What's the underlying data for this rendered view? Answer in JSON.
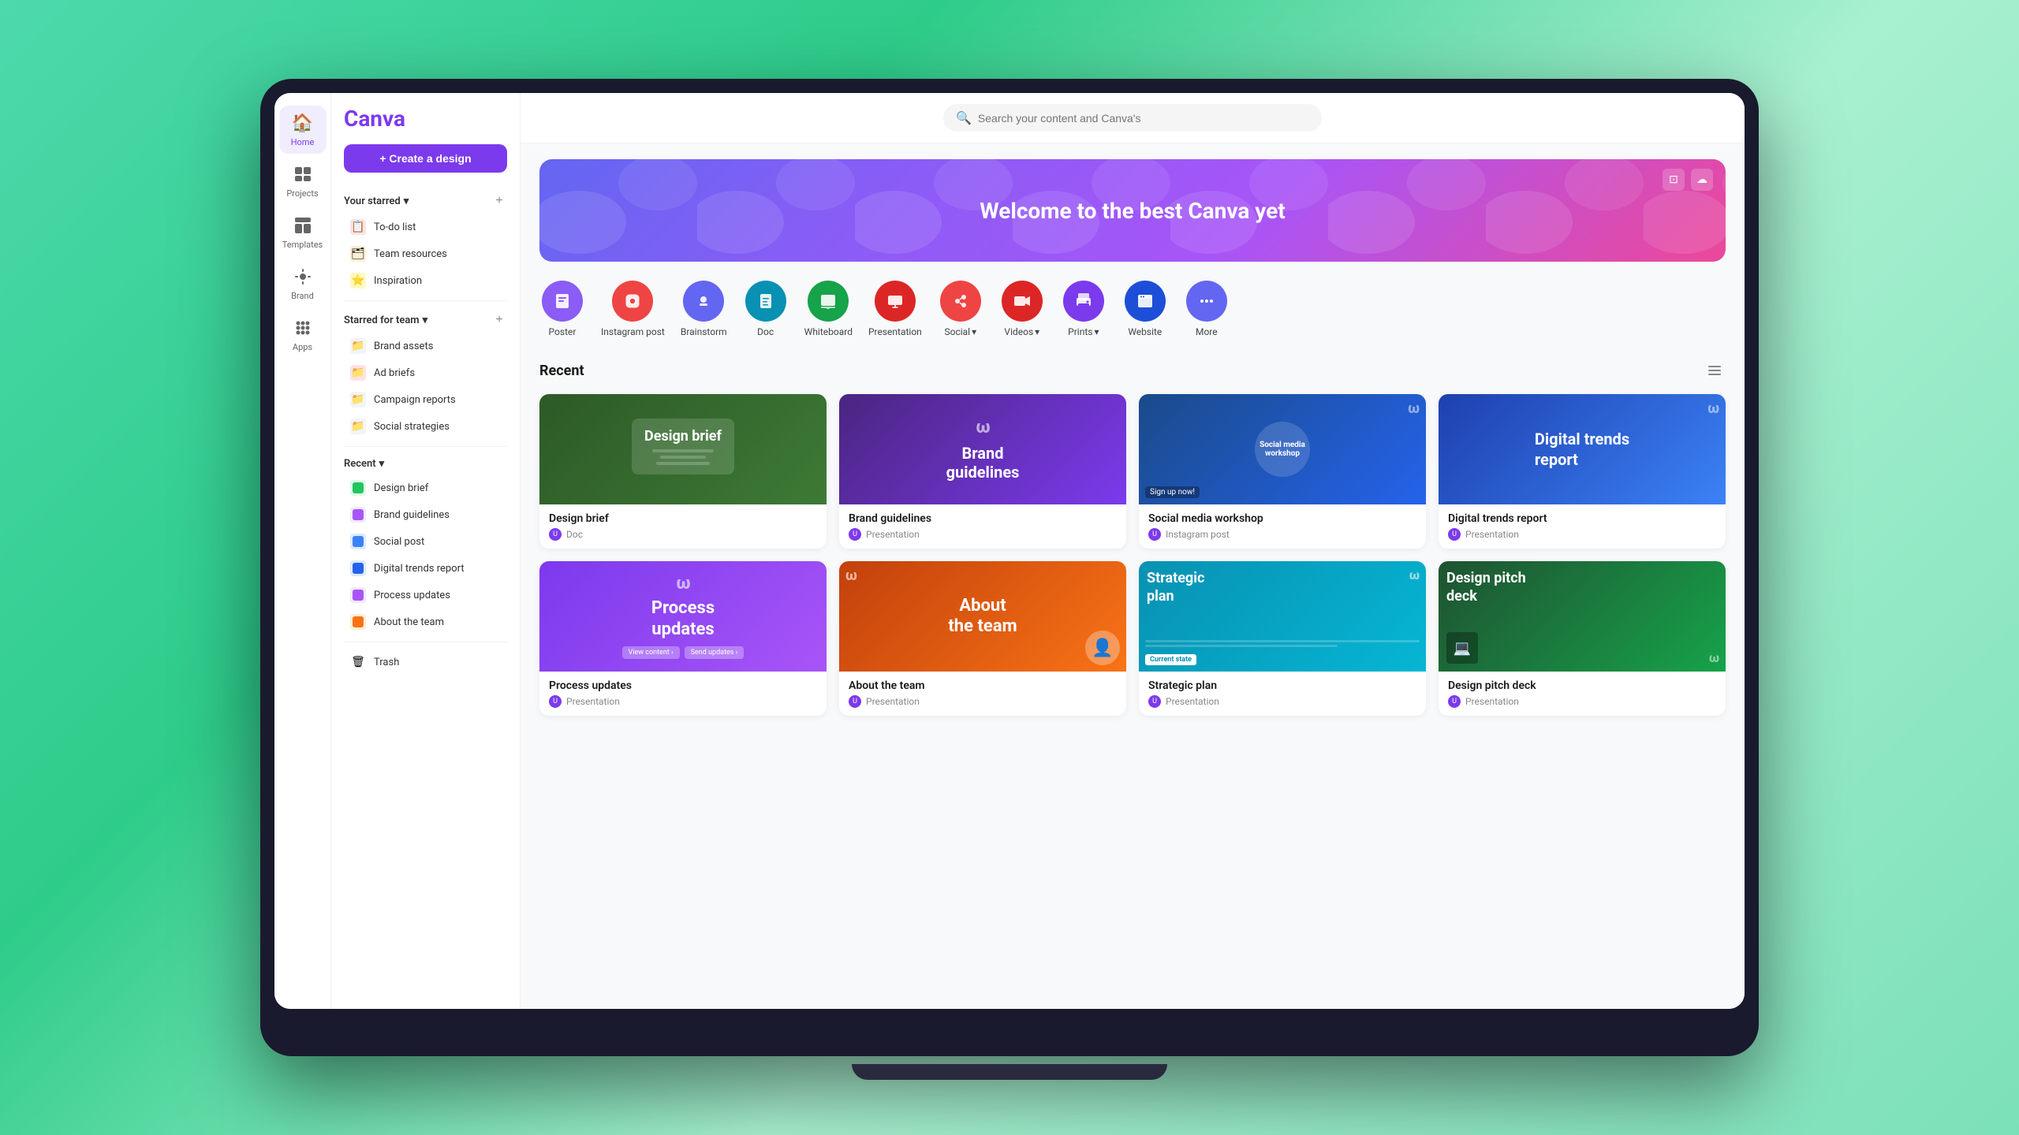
{
  "app": {
    "title": "Canva",
    "logo": "Canva"
  },
  "topbar": {
    "search_placeholder": "Search your content and Canva's"
  },
  "icon_sidebar": {
    "items": [
      {
        "id": "home",
        "label": "Home",
        "icon": "🏠",
        "active": true
      },
      {
        "id": "projects",
        "label": "Projects",
        "icon": "📁",
        "active": false
      },
      {
        "id": "templates",
        "label": "Templates",
        "icon": "⊞",
        "active": false
      },
      {
        "id": "brand",
        "label": "Brand",
        "icon": "◈",
        "active": false
      },
      {
        "id": "apps",
        "label": "Apps",
        "icon": "⋮⋮",
        "active": false
      }
    ]
  },
  "sidebar": {
    "create_btn": "+ Create a design",
    "starred_section": {
      "title": "Your starred",
      "dropdown_icon": "▾",
      "items": [
        {
          "id": "todo",
          "label": "To-do list",
          "icon": "📋",
          "color": "#ef4444"
        },
        {
          "id": "team-resources",
          "label": "Team resources",
          "icon": "🗂",
          "color": "#f97316"
        },
        {
          "id": "inspiration",
          "label": "Inspiration",
          "icon": "⭐",
          "color": "#eab308"
        }
      ]
    },
    "starred_for_team": {
      "title": "Starred for team",
      "dropdown_icon": "▾",
      "items": [
        {
          "id": "brand-assets",
          "label": "Brand assets",
          "icon": "📁",
          "color": "#94a3b8"
        },
        {
          "id": "ad-briefs",
          "label": "Ad briefs",
          "icon": "📁",
          "color": "#ef4444"
        },
        {
          "id": "campaign-reports",
          "label": "Campaign reports",
          "icon": "📁",
          "color": "#94a3b8"
        },
        {
          "id": "social-strategies",
          "label": "Social strategies",
          "icon": "📁",
          "color": "#94a3b8"
        }
      ]
    },
    "recent_section": {
      "title": "Recent",
      "dropdown_icon": "▾",
      "items": [
        {
          "id": "design-brief",
          "label": "Design brief",
          "icon": "🟩",
          "color": "#22c55e"
        },
        {
          "id": "brand-guidelines",
          "label": "Brand guidelines",
          "icon": "🟪",
          "color": "#a855f7"
        },
        {
          "id": "social-post",
          "label": "Social post",
          "icon": "🟦",
          "color": "#3b82f6"
        },
        {
          "id": "digital-trends",
          "label": "Digital trends report",
          "icon": "🟦",
          "color": "#3b82f6"
        },
        {
          "id": "process-updates",
          "label": "Process updates",
          "icon": "🟪",
          "color": "#a855f7"
        },
        {
          "id": "about-team",
          "label": "About the team",
          "icon": "🟧",
          "color": "#f97316"
        }
      ]
    },
    "trash_label": "Trash"
  },
  "hero": {
    "title": "Welcome to the best Canva yet"
  },
  "design_types": [
    {
      "id": "poster",
      "label": "Poster",
      "bg": "#8b5cf6"
    },
    {
      "id": "instagram-post",
      "label": "Instagram post",
      "bg": "#ef4444"
    },
    {
      "id": "brainstorm",
      "label": "Brainstorm",
      "bg": "#6366f1"
    },
    {
      "id": "doc",
      "label": "Doc",
      "bg": "#0891b2"
    },
    {
      "id": "whiteboard",
      "label": "Whiteboard",
      "bg": "#16a34a"
    },
    {
      "id": "presentation",
      "label": "Presentation",
      "bg": "#dc2626"
    },
    {
      "id": "social",
      "label": "Social",
      "bg": "#ef4444",
      "has_arrow": true
    },
    {
      "id": "videos",
      "label": "Videos",
      "bg": "#dc2626",
      "has_arrow": true
    },
    {
      "id": "prints",
      "label": "Prints",
      "bg": "#7c3aed",
      "has_arrow": true
    },
    {
      "id": "website",
      "label": "Website",
      "bg": "#1d4ed8"
    },
    {
      "id": "more",
      "label": "More",
      "bg": "#6366f1"
    }
  ],
  "recent_section": {
    "title": "Recent",
    "cards": [
      {
        "id": "design-brief",
        "title": "Design brief",
        "type": "Doc",
        "thumb_style": "design-brief",
        "thumb_text": "Design brief",
        "avatar_initials": "U"
      },
      {
        "id": "brand-guidelines",
        "title": "Brand guidelines",
        "type": "Presentation",
        "thumb_style": "brand-guidelines",
        "thumb_text": "Brand guidelines",
        "avatar_initials": "U"
      },
      {
        "id": "social-media-workshop",
        "title": "Social media workshop",
        "type": "Instagram post",
        "thumb_style": "social-media",
        "thumb_text": "Social media workshop",
        "avatar_initials": "U"
      },
      {
        "id": "digital-trends",
        "title": "Digital trends report",
        "type": "Presentation",
        "thumb_style": "digital-trends",
        "thumb_text": "Digital trends report",
        "avatar_initials": "U"
      },
      {
        "id": "process-updates",
        "title": "Process updates",
        "type": "Presentation",
        "thumb_style": "process-updates",
        "thumb_text": "Process updates",
        "avatar_initials": "U"
      },
      {
        "id": "about-the-team",
        "title": "About the team",
        "type": "Presentation",
        "thumb_style": "about-team",
        "thumb_text": "About the team",
        "avatar_initials": "U"
      },
      {
        "id": "strategic-plan",
        "title": "Strategic plan",
        "type": "Presentation",
        "thumb_style": "strategic-plan",
        "thumb_text": "Strategic plan",
        "avatar_initials": "U"
      },
      {
        "id": "design-pitch-deck",
        "title": "Design pitch deck",
        "type": "Presentation",
        "thumb_style": "design-pitch",
        "thumb_text": "Design pitch deck",
        "avatar_initials": "U"
      }
    ]
  }
}
